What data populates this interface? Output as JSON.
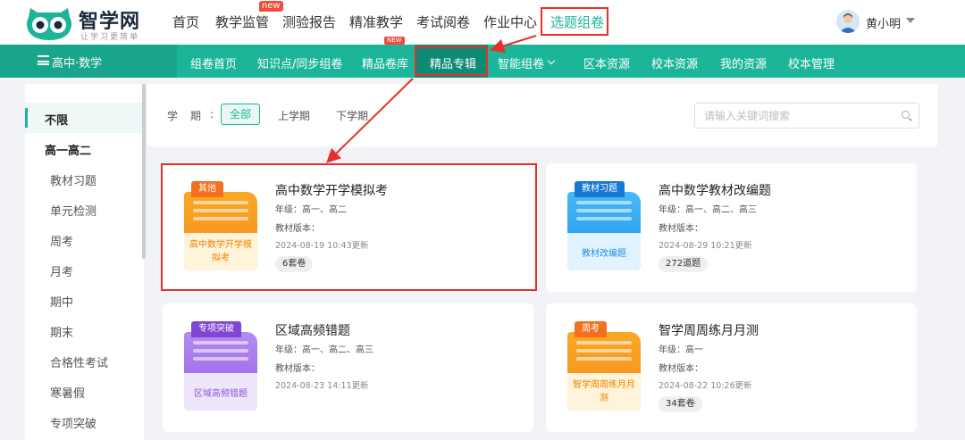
{
  "brand": {
    "title": "智学网",
    "slogan": "让学习更简单"
  },
  "top_nav": {
    "items": [
      {
        "label": "首页"
      },
      {
        "label": "教学监管"
      },
      {
        "label": "测验报告"
      },
      {
        "label": "精准教学"
      },
      {
        "label": "考试阅卷"
      },
      {
        "label": "作业中心"
      },
      {
        "label": "选题组卷"
      }
    ],
    "new_badge": "new",
    "user_name": "黄小明"
  },
  "sub_nav": {
    "subject": "高中·数学",
    "items": [
      {
        "label": "组卷首页"
      },
      {
        "label": "知识点/同步组卷"
      },
      {
        "label": "精品卷库"
      },
      {
        "label": "精品专辑"
      },
      {
        "label": "智能组卷"
      },
      {
        "label": "区本资源"
      },
      {
        "label": "校本资源"
      },
      {
        "label": "我的资源"
      },
      {
        "label": "校本管理"
      }
    ],
    "new_badge": "NEW",
    "active": "精品专辑"
  },
  "sidebar": {
    "items": [
      {
        "label": "不限",
        "active": true
      },
      {
        "label": "高一高二"
      },
      {
        "label": "教材习题"
      },
      {
        "label": "单元检测"
      },
      {
        "label": "周考"
      },
      {
        "label": "月考"
      },
      {
        "label": "期中"
      },
      {
        "label": "期末"
      },
      {
        "label": "合格性考试"
      },
      {
        "label": "寒暑假"
      },
      {
        "label": "专项突破"
      }
    ]
  },
  "filter": {
    "label": "学期",
    "options": [
      "全部",
      "上学期",
      "下学期"
    ],
    "selected": "全部",
    "search_placeholder": "请输入关键词搜索"
  },
  "cards": [
    {
      "title": "高中数学开学模拟考",
      "tag": "其他",
      "cover_text": "高中数学开学模拟考",
      "grade": "年级：高一、高二",
      "edition": "教材版本：",
      "date": "2024-08-19 10:43更新",
      "count": "6套卷",
      "theme": "orange"
    },
    {
      "title": "高中数学教材改编题",
      "tag": "教材习题",
      "cover_text": "教材改编题",
      "grade": "年级：高一、高二、高三",
      "edition": "教材版本：",
      "date": "2024-08-29 10:21更新",
      "count": "272道题",
      "theme": "blue"
    },
    {
      "title": "区域高频错题",
      "tag": "专项突破",
      "cover_text": "区域高频错题",
      "grade": "年级：高一、高二、高三",
      "edition": "教材版本：",
      "date": "2024-08-23 14:11更新",
      "count": "",
      "theme": "purple"
    },
    {
      "title": "智学周周练月月测",
      "tag": "周考",
      "cover_text": "智学周周练月月测",
      "grade": "年级：高一",
      "edition": "教材版本：",
      "date": "2024-08-22 10:26更新",
      "count": "34套卷",
      "theme": "orange"
    }
  ],
  "colors": {
    "brand_green": "#1cb59a",
    "subject_green": "#18a58c",
    "active_tab": "#0e8b74",
    "highlight_red": "#e8302a",
    "orange": "#f7a11a",
    "blue": "#2ea6f2",
    "purple": "#a475e8"
  }
}
